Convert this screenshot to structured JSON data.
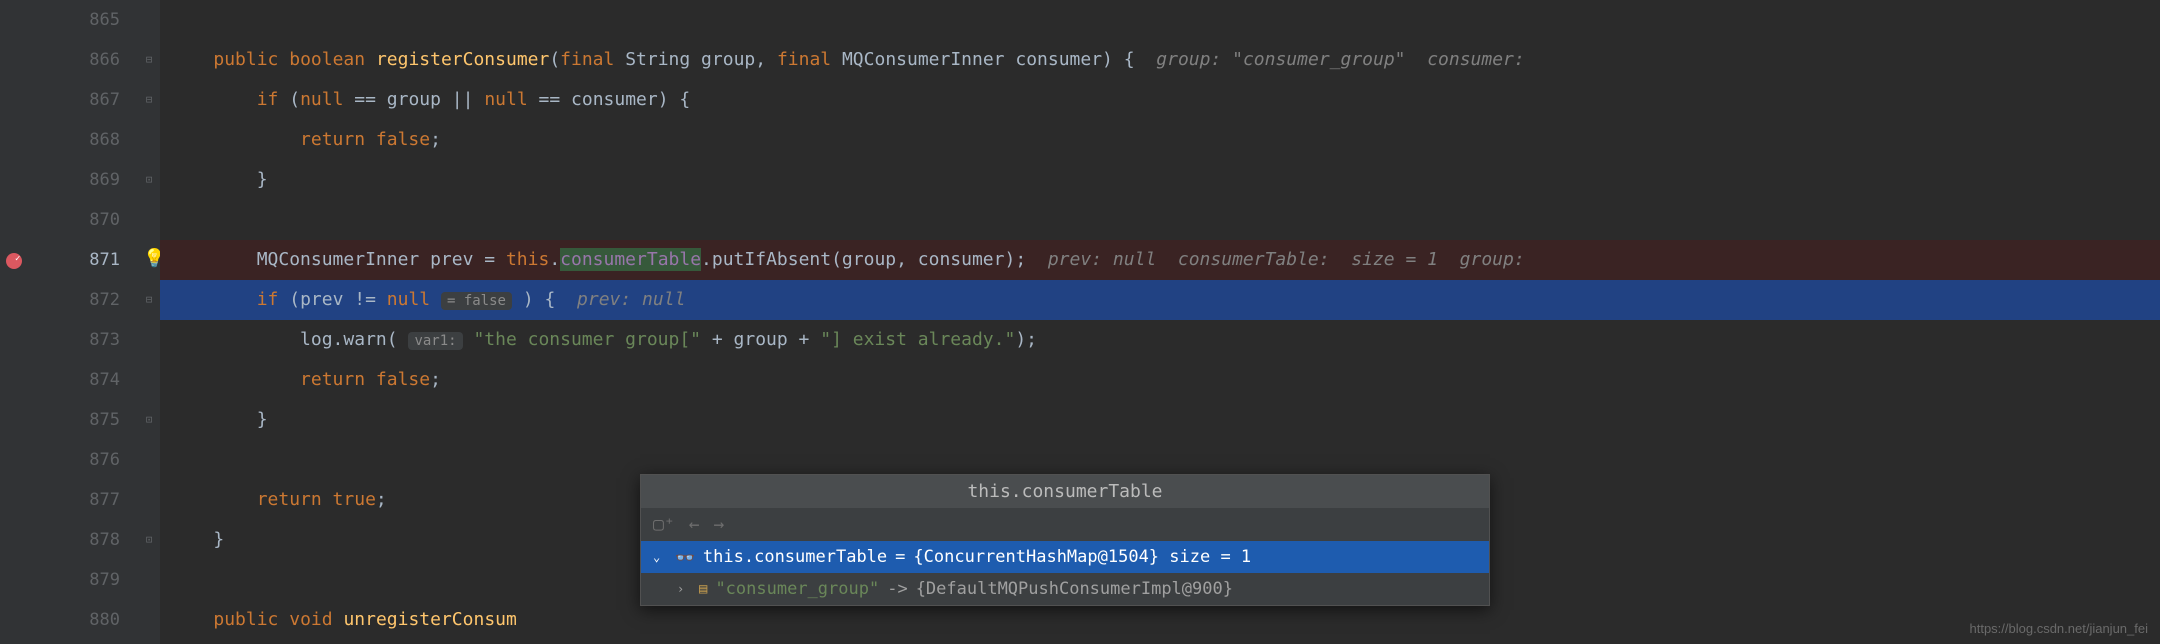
{
  "gutter": {
    "start": 865,
    "end": 880,
    "breakpoint_line": 871,
    "current_line": 872,
    "bulb_line": 871
  },
  "lines": {
    "l866": {
      "kw1": "public",
      "kw2": "boolean",
      "method": "registerConsumer",
      "kw3": "final",
      "t1": "String group,",
      "kw4": "final",
      "t2": "MQConsumerInner consumer) {",
      "hint": "group: \"consumer_group\"  consumer:"
    },
    "l867": {
      "kw1": "if",
      "cond1": "(",
      "kw2": "null",
      "cond2": " == group || ",
      "kw3": "null",
      "cond3": " == consumer) {"
    },
    "l868": {
      "kw1": "return false",
      "t": ";"
    },
    "l869": {
      "t": "}"
    },
    "l871": {
      "t1": "MQConsumerInner prev = ",
      "kw1": "this",
      "t2": ".",
      "field": "consumerTable",
      "t3": ".putIfAbsent(group, consumer);",
      "hint": "prev: null  consumerTable:  size = 1  group:"
    },
    "l872": {
      "kw1": "if",
      "t1": " (prev != ",
      "kw2": "null",
      "badge": "= false",
      "t2": ") {",
      "hint": "prev: null"
    },
    "l873": {
      "t1": "log.warn(",
      "badge": "var1:",
      "str1": "\"the consumer group[\"",
      "t2": " + group + ",
      "str2": "\"] exist already.\"",
      "t3": ");"
    },
    "l874": {
      "kw1": "return false",
      "t": ";"
    },
    "l875": {
      "t": "}"
    },
    "l877": {
      "kw1": "return true",
      "t": ";"
    },
    "l878": {
      "t": "}"
    },
    "l880": {
      "kw1": "public",
      "kw2": "void",
      "method": "unregisterConsum"
    }
  },
  "popup": {
    "title": "this.consumerTable",
    "row1": {
      "expr": "this.consumerTable",
      "eq": " = ",
      "val": "{ConcurrentHashMap@1504}  size = 1"
    },
    "row2": {
      "key": "\"consumer_group\"",
      "arrow": " -> ",
      "val": "{DefaultMQPushConsumerImpl@900}"
    }
  },
  "watermark": "https://blog.csdn.net/jianjun_fei"
}
